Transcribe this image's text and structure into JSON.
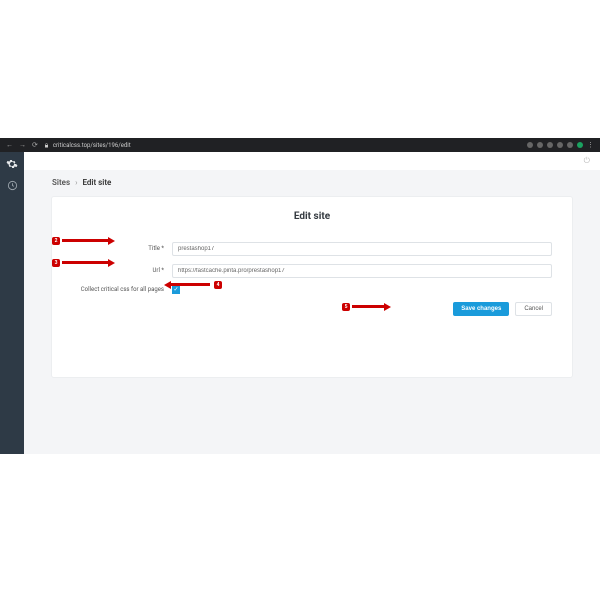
{
  "browser": {
    "url": "criticalcss.top/sites/196/edit"
  },
  "sidebar": {
    "icon1": "gear-icon",
    "icon2": "clock-icon"
  },
  "breadcrumb": {
    "root": "Sites",
    "current": "Edit site"
  },
  "card": {
    "title": "Edit site"
  },
  "form": {
    "title": {
      "label": "Title *",
      "value": "prestashop17"
    },
    "url": {
      "label": "Url *",
      "value": "https://fastcache.pinta.pro/prestashop17"
    },
    "collect": {
      "label": "Collect critical css for all pages",
      "checked": true
    }
  },
  "actions": {
    "save": "Save changes",
    "cancel": "Cancel"
  },
  "annotations": {
    "b2": "2",
    "b3": "3",
    "b4": "4",
    "b5": "5"
  }
}
